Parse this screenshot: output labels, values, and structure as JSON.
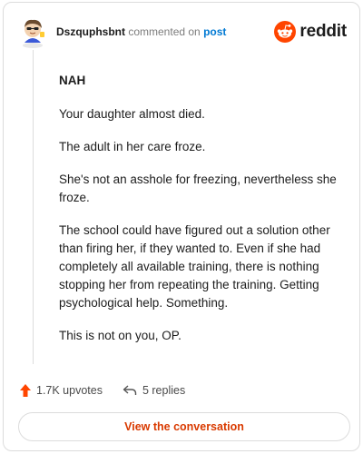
{
  "header": {
    "username": "Dszquphsbnt",
    "action_text": "commented on",
    "post_link": "post",
    "logo_text": "reddit"
  },
  "comment": {
    "paragraphs": [
      "NAH",
      "Your daughter almost died.",
      "The adult in her care froze.",
      "She's not an asshole for freezing, nevertheless she froze.",
      "The school could have figured out a solution other than firing her, if they wanted to. Even if she had completely all available training, there is nothing stopping her from repeating the training. Getting psychological help. Something.",
      "This is not on you, OP."
    ]
  },
  "footer": {
    "upvotes": "1.7K upvotes",
    "replies": "5 replies"
  },
  "cta": {
    "label": "View the conversation"
  },
  "colors": {
    "brand": "#ff4500",
    "link": "#0079d3",
    "cta_text": "#d93a00"
  },
  "icons": [
    "user-avatar",
    "reddit-logo-icon",
    "upvote-arrow-icon",
    "reply-arrow-icon"
  ]
}
